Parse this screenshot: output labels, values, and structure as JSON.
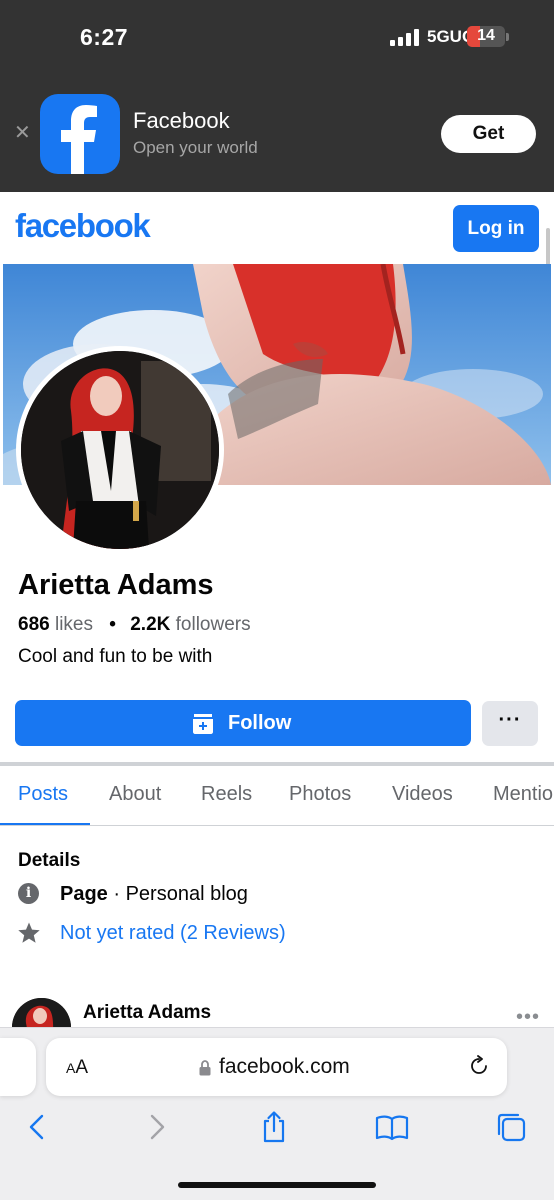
{
  "status_bar": {
    "time": "6:27",
    "network": "5GUC",
    "battery": "14",
    "battery_level_percent": 14,
    "battery_color": "#e5483c"
  },
  "app_banner": {
    "close_icon": "close-icon",
    "app_icon": "facebook-f-icon",
    "app_name": "Facebook",
    "tagline": "Open your world",
    "get_label": "Get"
  },
  "header": {
    "logo_text": "facebook",
    "login_label": "Log in",
    "brand_color": "#1877f2"
  },
  "profile": {
    "name": "Arietta Adams",
    "likes_count": "686",
    "likes_label": "likes",
    "followers_count": "2.2K",
    "followers_label": "followers",
    "bio": "Cool and fun to be with",
    "follow_label": "Follow",
    "follow_icon": "follow-page-icon",
    "more_label": "···"
  },
  "tabs": [
    {
      "label": "Posts",
      "active": true
    },
    {
      "label": "About",
      "active": false
    },
    {
      "label": "Reels",
      "active": false
    },
    {
      "label": "Photos",
      "active": false
    },
    {
      "label": "Videos",
      "active": false
    },
    {
      "label": "Mentions",
      "active": false
    }
  ],
  "details": {
    "title": "Details",
    "info_icon": "i",
    "category_prefix": "Page",
    "category_separator": " · ",
    "category": "Personal blog",
    "rating_icon": "star-icon",
    "rating_text": "Not yet rated (2 Reviews)"
  },
  "post": {
    "author": "Arietta Adams",
    "more_label": "•••"
  },
  "safari": {
    "aa_large": "A",
    "aa_small": "A",
    "url": "facebook.com",
    "toolbar_icons": [
      "back-icon",
      "forward-icon",
      "share-icon",
      "bookmarks-icon",
      "tabs-icon"
    ]
  }
}
